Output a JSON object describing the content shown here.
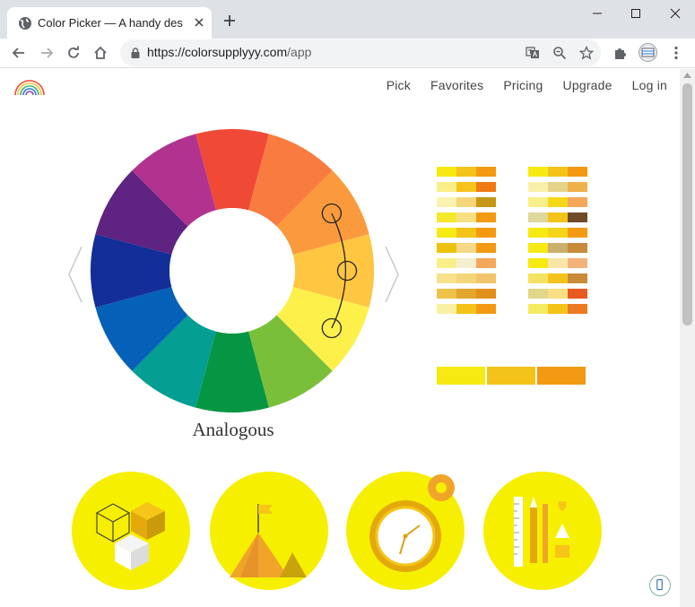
{
  "browser": {
    "tab_title": "Color Picker — A handy design",
    "url_host": "https://colorsupplyyy.com",
    "url_path": "/app"
  },
  "nav": {
    "items": [
      "Pick",
      "Favorites",
      "Pricing",
      "Upgrade",
      "Log in"
    ]
  },
  "wheel": {
    "colors": [
      "#f04a37",
      "#f87c40",
      "#fa9a3c",
      "#fec641",
      "#fdf04b",
      "#7abf3a",
      "#069542",
      "#049e92",
      "#0560b7",
      "#132e99",
      "#5f2381",
      "#b1338f"
    ],
    "selected_segments": [
      2,
      3,
      4
    ]
  },
  "scheme": {
    "name": "Analogous"
  },
  "palettes": {
    "left": [
      [
        "#f6ea12",
        "#f4c31a",
        "#f39a12"
      ],
      [
        "#f8ef8a",
        "#f5c41a",
        "#ef7a14"
      ],
      [
        "#fbf2b0",
        "#f4d67a",
        "#c59714"
      ],
      [
        "#f5e82a",
        "#f7e083",
        "#f39a12"
      ],
      [
        "#f6ea12",
        "#f4c31a",
        "#f39a12"
      ],
      [
        "#ecc20c",
        "#f5d88a",
        "#f39a12"
      ],
      [
        "#f8ef8a",
        "#f6eed0",
        "#f3a85a"
      ],
      [
        "#f6e28a",
        "#f4d67a",
        "#f2c46a"
      ],
      [
        "#efc24a",
        "#e2a52e",
        "#e2901a"
      ],
      [
        "#f9f0a4",
        "#f4c31a",
        "#f39a12"
      ]
    ],
    "right": [
      [
        "#f6ea12",
        "#f4c31a",
        "#f39a12"
      ],
      [
        "#f8f0a8",
        "#e5d38a",
        "#efb14a"
      ],
      [
        "#f8ef8a",
        "#f5d81a",
        "#f3a85a"
      ],
      [
        "#ded89a",
        "#f4c31a",
        "#6e4a26"
      ],
      [
        "#f6ea12",
        "#f4d51a",
        "#f39a12"
      ],
      [
        "#f6ea12",
        "#c9b06c",
        "#c98a3a"
      ],
      [
        "#f6ea12",
        "#f8e6a8",
        "#f3b27a"
      ],
      [
        "#f6e262",
        "#f4c31a",
        "#c98a3a"
      ],
      [
        "#e0d888",
        "#f7e083",
        "#e85a22"
      ],
      [
        "#f6ea62",
        "#f4c31a",
        "#ec7a22"
      ]
    ],
    "main": [
      "#f6ea12",
      "#f4c31a",
      "#f39a12"
    ]
  },
  "features": [
    {
      "icon": "cubes-icon"
    },
    {
      "icon": "mountain-flag-icon"
    },
    {
      "icon": "clock-gear-icon"
    },
    {
      "icon": "design-tools-icon"
    }
  ],
  "accent": "#f7ef00"
}
